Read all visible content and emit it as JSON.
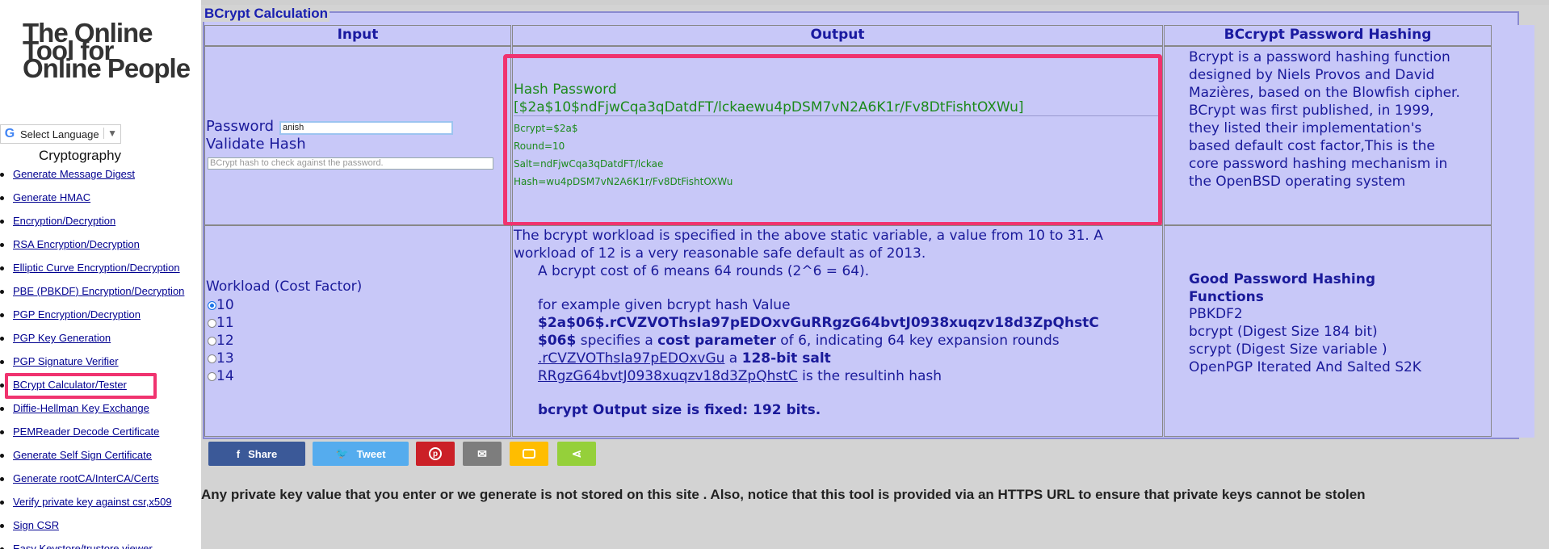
{
  "sidebar": {
    "logo": "The Online Tool for Online People",
    "language": "Select Language",
    "category": "Cryptography",
    "items": [
      {
        "label": "Generate Message Digest"
      },
      {
        "label": "Generate HMAC"
      },
      {
        "label": "Encryption/Decryption"
      },
      {
        "label": "RSA Encryption/Decryption"
      },
      {
        "label": "Elliptic Curve Encryption/Decryption"
      },
      {
        "label": "PBE (PBKDF) Encryption/Decryption"
      },
      {
        "label": "PGP Encryption/Decryption"
      },
      {
        "label": "PGP Key Generation"
      },
      {
        "label": "PGP Signature Verifier"
      },
      {
        "label": "BCrypt Calculator/Tester"
      },
      {
        "label": "Diffie-Hellman Key Exchange"
      },
      {
        "label": "PEMReader Decode Certificate"
      },
      {
        "label": "Generate Self Sign Certificate"
      },
      {
        "label": "Generate rootCA/InterCA/Certs"
      },
      {
        "label": "Verify private key against csr,x509"
      },
      {
        "label": "Sign CSR"
      },
      {
        "label": "Easy Keystore/trustore viewer"
      }
    ]
  },
  "main": {
    "legend": "BCrypt Calculation",
    "headers": {
      "input": "Input",
      "output": "Output",
      "info": "BCcrypt Password Hashing"
    },
    "input": {
      "password_label": "Password",
      "password_value": "anish",
      "validate_label": "Validate Hash",
      "validate_placeholder": "BCrypt hash to check against the password.",
      "workload_label": "Workload (Cost Factor)",
      "options": [
        "10",
        "11",
        "12",
        "13",
        "14"
      ],
      "selected": "10"
    },
    "output": {
      "hash_title": "Hash Password",
      "hash_value": "[$2a$10$ndFjwCqa3qDatdFT/lckaewu4pDSM7vN2A6K1r/Fv8DtFishtOXWu]",
      "bcrypt": "Bcrypt=$2a$",
      "round": "Round=10",
      "salt": "Salt=ndFjwCqa3qDatdFT/lckae",
      "hash": "Hash=wu4pDSM7vN2A6K1r/Fv8DtFishtOXWu",
      "workload_desc1": "The bcrypt workload is specified in the above static variable, a value from 10 to 31. A",
      "workload_desc2": "workload of 12 is a very reasonable safe default as of 2013.",
      "cost_desc": "A bcrypt cost of 6 means 64 rounds (2^6 = 64).",
      "example_intro": "for example given bcrypt hash Value",
      "example_hash": "$2a$06$.rCVZVOThsIa97pEDOxvGuRRgzG64bvtJ0938xuqzv18d3ZpQhstC",
      "example_prefix": "$06$",
      "example_specifies": " specifies a ",
      "cost_parameter": "cost parameter",
      "example_rounds": " of 6, indicating 64 key expansion rounds",
      "salt_link": ".rCVZVOThsIa97pEDOxvGu",
      "salt_a": " a ",
      "salt_label": "128-bit salt",
      "result_link": "RRgzG64bvtJ0938xuqzv18d3ZpQhstC",
      "result_text": " is the resultinh hash",
      "output_size": "bcrypt Output size is fixed: 192 bits."
    },
    "info": {
      "description": "Bcrypt is a password hashing function designed by Niels Provos and David Mazières, based on the Blowfish cipher. BCrypt was first published, in 1999, they listed their implementation's based default cost factor,This is the core password hashing mechanism in the OpenBSD operating system",
      "good_title": "Good Password Hashing Functions",
      "functions": [
        "PBKDF2",
        "bcrypt (Digest Size 184 bit)",
        "scrypt (Digest Size variable )",
        "OpenPGP Iterated And Salted S2K"
      ]
    }
  },
  "share": {
    "facebook": "Share",
    "twitter": "Tweet"
  },
  "disclaimer": "Any private key value that you enter or we generate is not stored on this site . Also, notice that this tool is provided via an HTTPS URL to ensure that private keys cannot be stolen",
  "colors": {
    "facebook": "#3b5998",
    "twitter": "#55acee",
    "pinterest": "#cb2027",
    "email": "#7d7d7d",
    "sms": "#ffbd00",
    "sharethis": "#95d03a",
    "highlight": "#f0336f"
  }
}
